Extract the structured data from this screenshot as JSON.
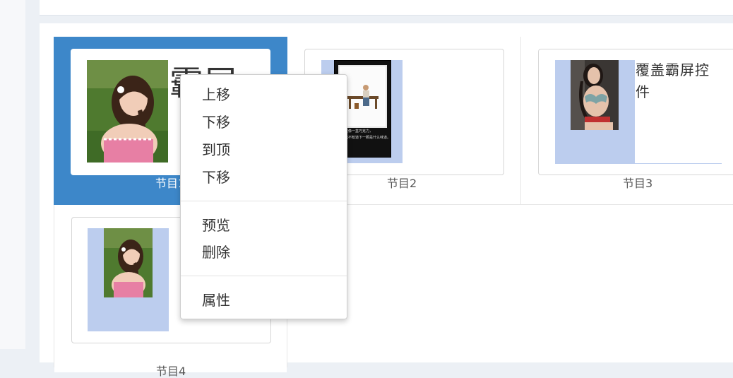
{
  "programs": [
    {
      "caption": "节目1",
      "overlay_text": "霸屏"
    },
    {
      "caption": "节目2",
      "poster_line1": "生活就像一盒巧克力，",
      "poster_line2": "你永远不知道下一颗是什么味道。"
    },
    {
      "caption": "节目3",
      "overlay_text": "覆盖霸屏控件"
    },
    {
      "caption": "节目4"
    }
  ],
  "context_menu": {
    "items": [
      "上移",
      "下移",
      "到顶",
      "下移",
      "预览",
      "删除",
      "属性"
    ]
  },
  "colors": {
    "selected": "#3d87c9",
    "placeholder": "#bccdee",
    "background": "#ecf0f5"
  }
}
